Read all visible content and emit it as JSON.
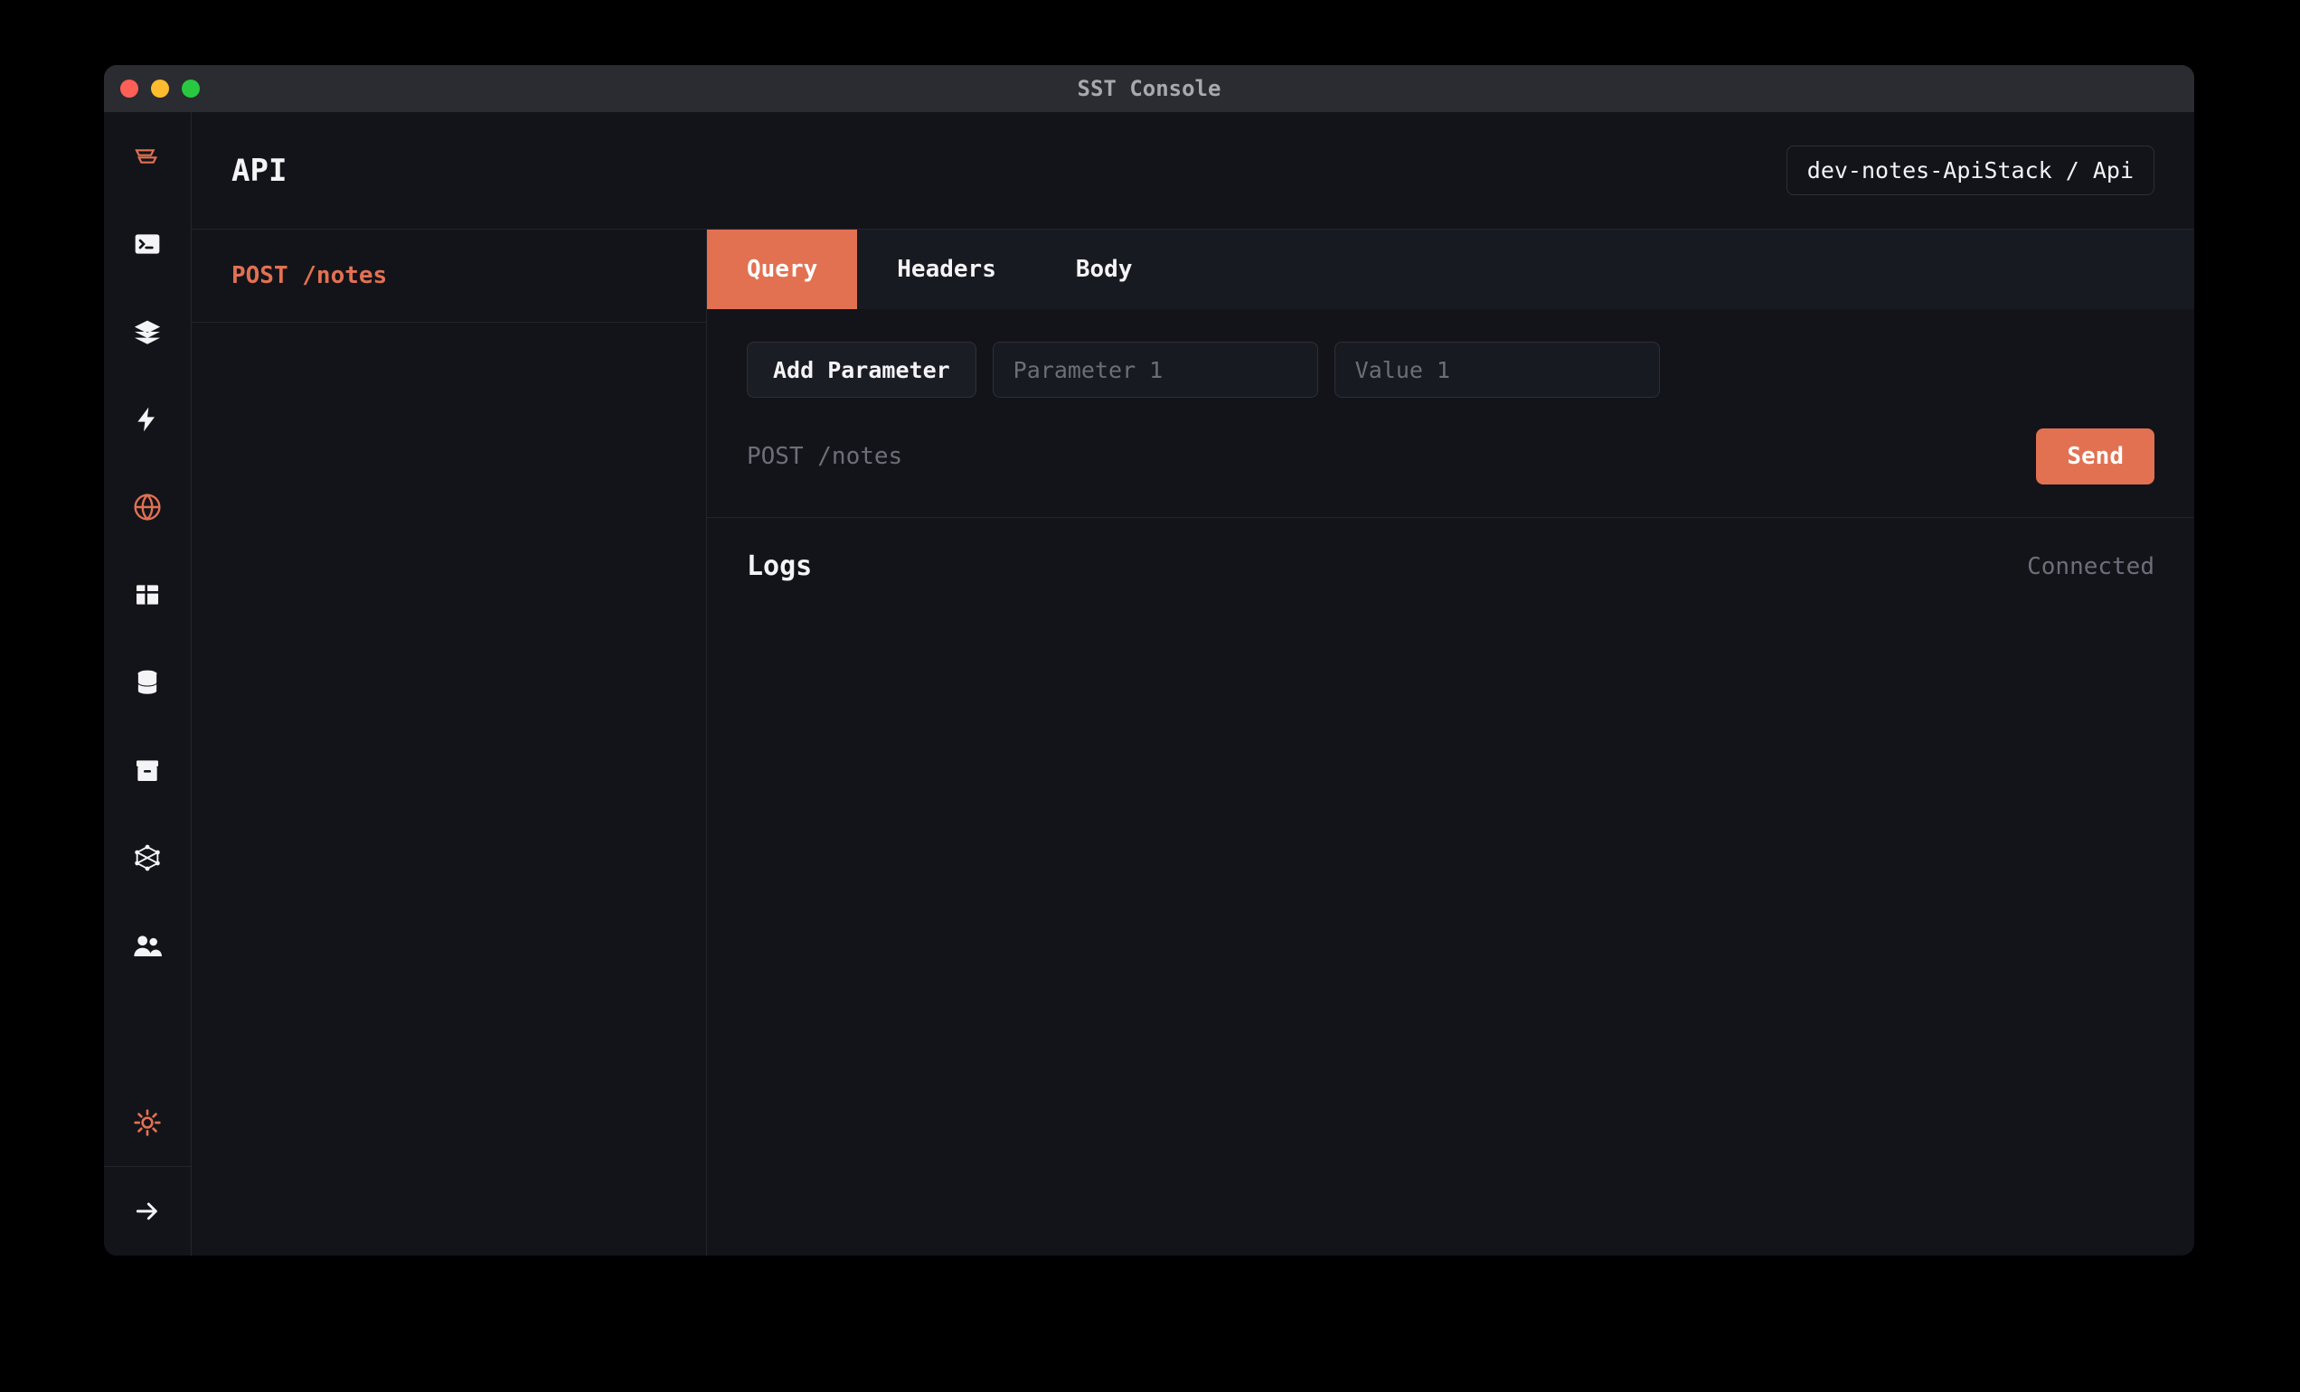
{
  "window_title": "SST Console",
  "header": {
    "title": "API",
    "stack": "dev-notes-ApiStack / Api"
  },
  "sidebar": [
    {
      "name": "logo-icon",
      "accent": true,
      "icon": "logo"
    },
    {
      "name": "local-icon",
      "accent": false,
      "icon": "terminal"
    },
    {
      "name": "stacks-icon",
      "accent": false,
      "icon": "layers"
    },
    {
      "name": "functions-icon",
      "accent": false,
      "icon": "bolt"
    },
    {
      "name": "api-icon",
      "accent": true,
      "icon": "globe"
    },
    {
      "name": "table-icon",
      "accent": false,
      "icon": "table"
    },
    {
      "name": "rds-icon",
      "accent": false,
      "icon": "database"
    },
    {
      "name": "buckets-icon",
      "accent": false,
      "icon": "archive"
    },
    {
      "name": "graphql-icon",
      "accent": false,
      "icon": "graphql"
    },
    {
      "name": "cognito-icon",
      "accent": false,
      "icon": "users"
    }
  ],
  "bottom_sidebar": [
    {
      "name": "theme-icon",
      "accent": true,
      "icon": "sun"
    },
    {
      "name": "expand-icon",
      "accent": false,
      "icon": "arrow-right"
    }
  ],
  "routes": [
    {
      "label": "POST /notes"
    }
  ],
  "tabs": [
    {
      "label": "Query",
      "active": true
    },
    {
      "label": "Headers",
      "active": false
    },
    {
      "label": "Body",
      "active": false
    }
  ],
  "query": {
    "add_label": "Add Parameter",
    "param_placeholder": "Parameter 1",
    "value_placeholder": "Value 1"
  },
  "send": {
    "route": "POST /notes",
    "button": "Send"
  },
  "logs": {
    "title": "Logs",
    "status": "Connected"
  },
  "icons": {
    "logo": "<path d='M3 7h14l-2 4H5l-2-4zm2 6h14l-2 4H7l-2-4z' fill='none' stroke='currentColor' stroke-width='1.6'/>",
    "terminal": "<rect x='2' y='4' width='20' height='16' rx='2' fill='currentColor'/><path d='M6 9l3 3-3 3M11 15h5' stroke='#13141a' stroke-width='2' fill='none' stroke-linecap='round'/>",
    "layers": "<path d='M12 3l10 5-10 5L2 8l10-5zm-10 9l10 5 10-5M2 17l10 5 10-5' fill='currentColor' stroke='currentColor' stroke-width='0.5'/>",
    "bolt": "<path d='M13 2L4 14h6l-1 8 9-12h-6l1-8z' fill='currentColor'/>",
    "globe": "<circle cx='12' cy='12' r='10' fill='none' stroke='currentColor' stroke-width='1.8'/><path d='M2 12h20M12 2c3 3 4 7 4 10s-1 7-4 10c-3-3-4-7-4-10s1-7 4-10z' fill='none' stroke='currentColor' stroke-width='1.8'/>",
    "table": "<rect x='3' y='4' width='18' height='16' rx='1' fill='currentColor'/><path d='M3 10h18M11 4v16' stroke='#13141a' stroke-width='2'/>",
    "database": "<ellipse cx='12' cy='5' rx='8' ry='3' fill='currentColor'/><path d='M4 5v7c0 1.7 3.6 3 8 3s8-1.3 8-3V5M4 12v7c0 1.7 3.6 3 8 3s8-1.3 8-3v-7' fill='currentColor' stroke='#13141a' stroke-width='0.8'/>",
    "archive": "<rect x='3' y='4' width='18' height='5' rx='1' fill='currentColor'/><rect x='4' y='9' width='16' height='12' rx='1' fill='currentColor'/><rect x='9' y='12' width='6' height='2' rx='1' fill='#13141a'/>",
    "graphql": "<circle cx='12' cy='3' r='1.8' fill='currentColor'/><circle cx='12' cy='21' r='1.8' fill='currentColor'/><circle cx='3.5' cy='7.5' r='1.8' fill='currentColor'/><circle cx='20.5' cy='7.5' r='1.8' fill='currentColor'/><circle cx='3.5' cy='16.5' r='1.8' fill='currentColor'/><circle cx='20.5' cy='16.5' r='1.8' fill='currentColor'/><path d='M12 3L3.5 7.5v9L12 21l8.5-4.5v-9L12 3zM3.5 7.5L20.5 16.5M20.5 7.5L3.5 16.5' fill='none' stroke='currentColor' stroke-width='1.4'/>",
    "users": "<circle cx='8' cy='8' r='4' fill='currentColor'/><circle cx='17' cy='9' r='3.2' fill='currentColor'/><path d='M1 21c0-4 3-7 7-7s7 3 7 7M14 21c0-3 2-5.5 5-5.5s5 2.5 5 5.5' fill='currentColor'/>",
    "sun": "<circle cx='12' cy='12' r='4' fill='none' stroke='currentColor' stroke-width='2'/><path d='M12 2v3M12 19v3M2 12h3M19 12h3M4.9 4.9l2.1 2.1M17 17l2.1 2.1M4.9 19.1L7 17M17 7l2.1-2.1' stroke='currentColor' stroke-width='2' stroke-linecap='round'/>",
    "arrow-right": "<path d='M4 12h15M13 6l6 6-6 6' fill='none' stroke='currentColor' stroke-width='2.2' stroke-linecap='round' stroke-linejoin='round'/>"
  }
}
